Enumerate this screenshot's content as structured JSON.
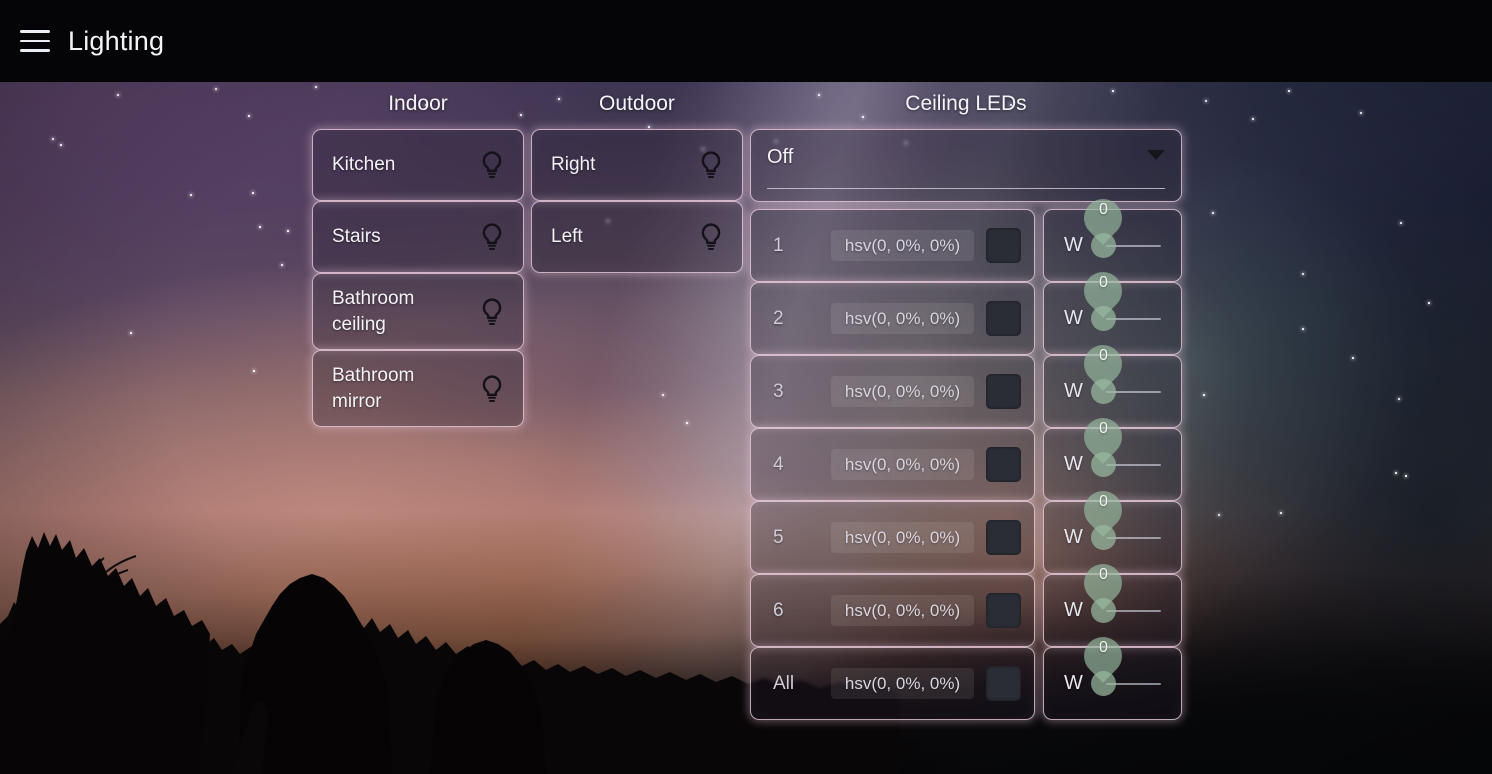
{
  "header": {
    "menu_icon": "hamburger-menu-icon",
    "title": "Lighting"
  },
  "columns": {
    "indoor_title": "Indoor",
    "outdoor_title": "Outdoor",
    "ceiling_title": "Ceiling LEDs"
  },
  "indoor": {
    "lights": [
      {
        "name": "Kitchen",
        "icon": "light-bulb-icon"
      },
      {
        "name": "Stairs",
        "icon": "light-bulb-icon"
      },
      {
        "name": "Bathroom\nceiling",
        "icon": "light-bulb-icon"
      },
      {
        "name": "Bathroom\nmirror",
        "icon": "light-bulb-icon"
      }
    ]
  },
  "outdoor": {
    "lights": [
      {
        "name": "Right",
        "icon": "light-bulb-icon"
      },
      {
        "name": "Left",
        "icon": "light-bulb-icon"
      }
    ]
  },
  "ceiling_leds": {
    "mode_select": {
      "value": "Off",
      "arrow_icon": "chevron-down-icon"
    },
    "rows": [
      {
        "index": "1",
        "hsv": "hsv(0, 0%, 0%)",
        "swatch_color": "#2b2d36",
        "white_label": "W",
        "white_value": "0"
      },
      {
        "index": "2",
        "hsv": "hsv(0, 0%, 0%)",
        "swatch_color": "#2b2d36",
        "white_label": "W",
        "white_value": "0"
      },
      {
        "index": "3",
        "hsv": "hsv(0, 0%, 0%)",
        "swatch_color": "#2b2d36",
        "white_label": "W",
        "white_value": "0"
      },
      {
        "index": "4",
        "hsv": "hsv(0, 0%, 0%)",
        "swatch_color": "#2b2d36",
        "white_label": "W",
        "white_value": "0"
      },
      {
        "index": "5",
        "hsv": "hsv(0, 0%, 0%)",
        "swatch_color": "#2b2d36",
        "white_label": "W",
        "white_value": "0"
      },
      {
        "index": "6",
        "hsv": "hsv(0, 0%, 0%)",
        "swatch_color": "#2b2d36",
        "white_label": "W",
        "white_value": "0"
      },
      {
        "index": "All",
        "hsv": "hsv(0, 0%, 0%)",
        "swatch_color": "#2b2d36",
        "white_label": "W",
        "white_value": "0"
      }
    ]
  },
  "colors": {
    "card_border": "#ecced e",
    "appbar_bg": "#050507",
    "slider_accent": "#96ba9e",
    "text_primary": "#f3f2f6"
  }
}
